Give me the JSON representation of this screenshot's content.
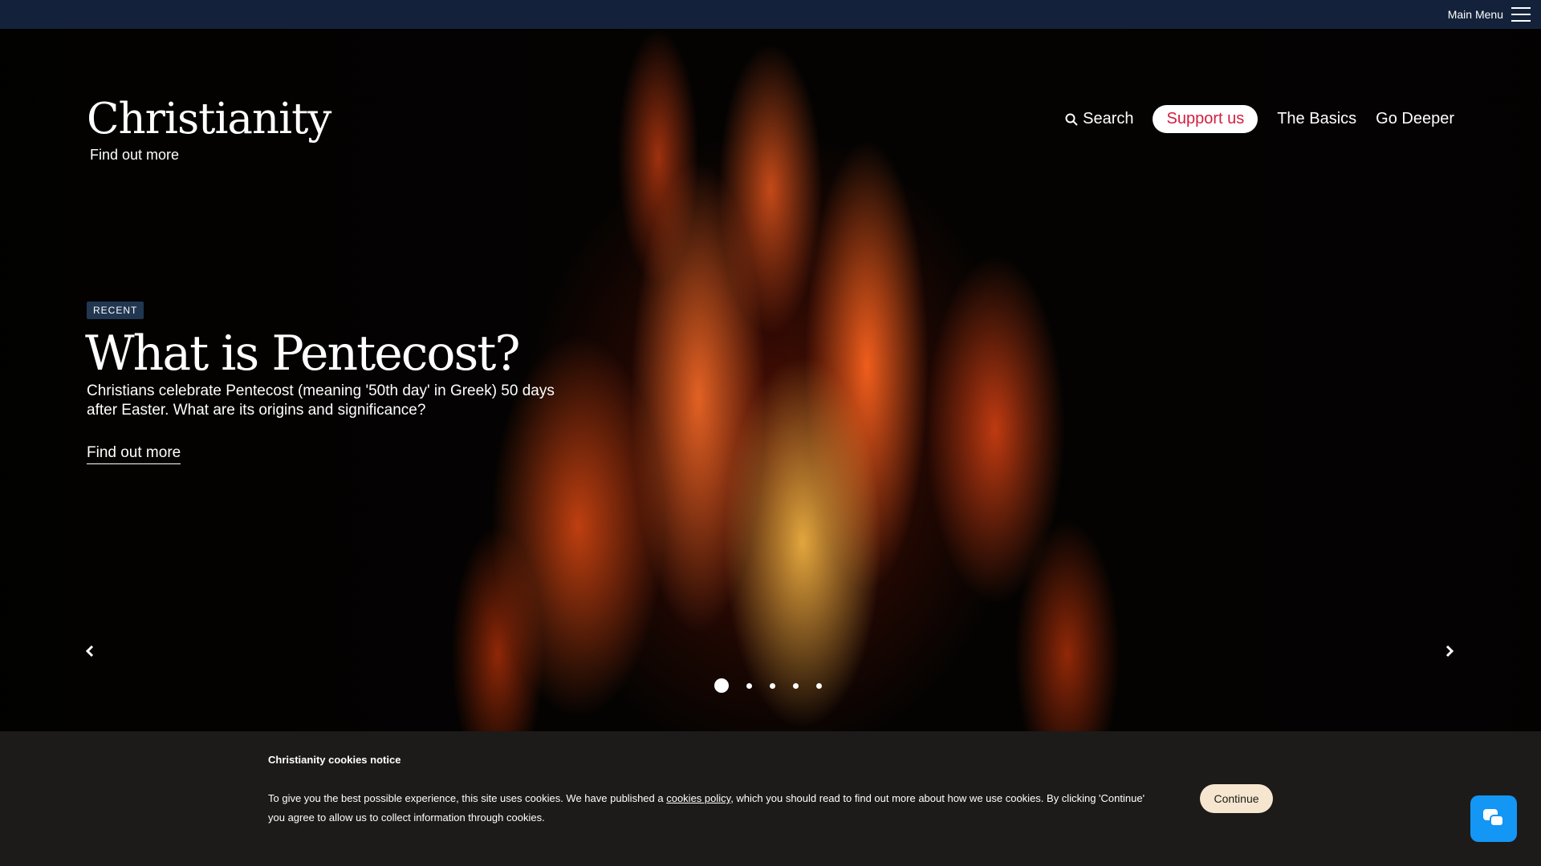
{
  "topbar": {
    "menu_label": "Main Menu"
  },
  "logo": {
    "title": "Christianity",
    "subtitle": "Find out more"
  },
  "nav": {
    "search": "Search",
    "support": "Support us",
    "basics": "The Basics",
    "deeper": "Go Deeper"
  },
  "hero": {
    "badge": "RECENT",
    "title": "What is Pentecost?",
    "description": "Christians celebrate Pentecost (meaning '50th day' in Greek) 50 days after Easter. What are its origins and significance?",
    "cta": "Find out more",
    "slides_total": 5,
    "active_slide": 1
  },
  "cookie": {
    "title": "Christianity cookies notice",
    "text_before": "To give you the best possible experience, this site uses cookies. We have published a ",
    "link": "cookies policy",
    "text_after": ", which you should read to find out more about how we use cookies. By clicking 'Continue' you agree to allow us to collect information through cookies.",
    "button": "Continue"
  },
  "colors": {
    "topbar": "#13223a",
    "support_text": "#d31f3f",
    "badge": "#213650",
    "chat": "#1496f4",
    "continue_bg": "#f6e6cf"
  },
  "icons": {
    "search": "search-icon",
    "menu": "hamburger-icon",
    "prev": "chevron-left-icon",
    "next": "chevron-right-icon",
    "chat": "chat-icon"
  }
}
